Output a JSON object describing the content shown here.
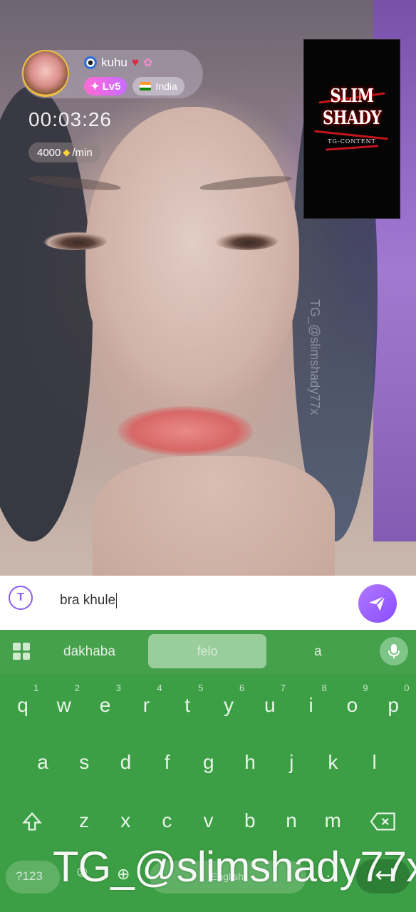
{
  "caller": {
    "name": "kuhu",
    "level": "Lv5",
    "country": "India",
    "timer": "00:03:26",
    "rate": "4000",
    "rate_unit": "/min"
  },
  "self_preview": {
    "logo_text": "SLIM SHADY",
    "logo_sub": "TG-CONTENT"
  },
  "side_watermark": "TG_@slimshady77x",
  "chat": {
    "input_value": "bra khule"
  },
  "keyboard": {
    "suggestions": [
      "dakhaba",
      "felo",
      "a"
    ],
    "row1": [
      {
        "k": "q",
        "h": "1"
      },
      {
        "k": "w",
        "h": "2"
      },
      {
        "k": "e",
        "h": "3"
      },
      {
        "k": "r",
        "h": "4"
      },
      {
        "k": "t",
        "h": "5"
      },
      {
        "k": "y",
        "h": "6"
      },
      {
        "k": "u",
        "h": "7"
      },
      {
        "k": "i",
        "h": "8"
      },
      {
        "k": "o",
        "h": "9"
      },
      {
        "k": "p",
        "h": "0"
      }
    ],
    "row2": [
      "a",
      "s",
      "d",
      "f",
      "g",
      "h",
      "j",
      "k",
      "l"
    ],
    "row3": [
      "z",
      "x",
      "c",
      "v",
      "b",
      "n",
      "m"
    ],
    "symbols_label": "?123",
    "space_label": "English"
  },
  "watermark": "TG_@slimshady77x"
}
